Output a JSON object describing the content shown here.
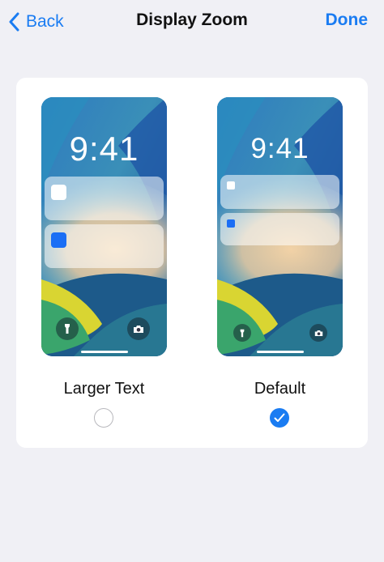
{
  "colors": {
    "accent": "#1a7cf2"
  },
  "nav": {
    "back_label": "Back",
    "back_icon": "chevron-left-icon",
    "title": "Display Zoom",
    "done_label": "Done"
  },
  "options": [
    {
      "label": "Larger Text",
      "selected": false,
      "preview": {
        "time": "9:41",
        "notifications": 2,
        "icons": [
          "flashlight-icon",
          "camera-icon"
        ]
      }
    },
    {
      "label": "Default",
      "selected": true,
      "preview": {
        "time": "9:41",
        "notifications": 2,
        "icons": [
          "flashlight-icon",
          "camera-icon"
        ]
      }
    }
  ]
}
